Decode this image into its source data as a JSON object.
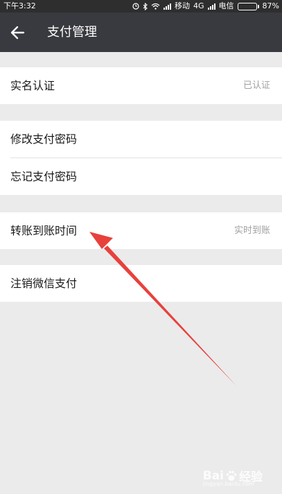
{
  "status_bar": {
    "time": "下午3:32",
    "carrier1": "移动",
    "network": "4G",
    "carrier2": "电信",
    "battery_text": "87%",
    "battery_level": 0.87
  },
  "header": {
    "title": "支付管理"
  },
  "groups": [
    {
      "items": [
        {
          "label": "实名认证",
          "value": "已认证"
        }
      ]
    },
    {
      "items": [
        {
          "label": "修改支付密码",
          "value": ""
        },
        {
          "label": "忘记支付密码",
          "value": ""
        }
      ]
    },
    {
      "items": [
        {
          "label": "转账到账时间",
          "value": "实时到账"
        }
      ]
    },
    {
      "items": [
        {
          "label": "注销微信支付",
          "value": ""
        }
      ]
    }
  ],
  "watermark": {
    "brand": "Bai",
    "brand2": "经验",
    "url": "jingyan.baidu.com"
  },
  "colors": {
    "title_bar": "#393a3f",
    "annotation_arrow": "#e8413c"
  }
}
